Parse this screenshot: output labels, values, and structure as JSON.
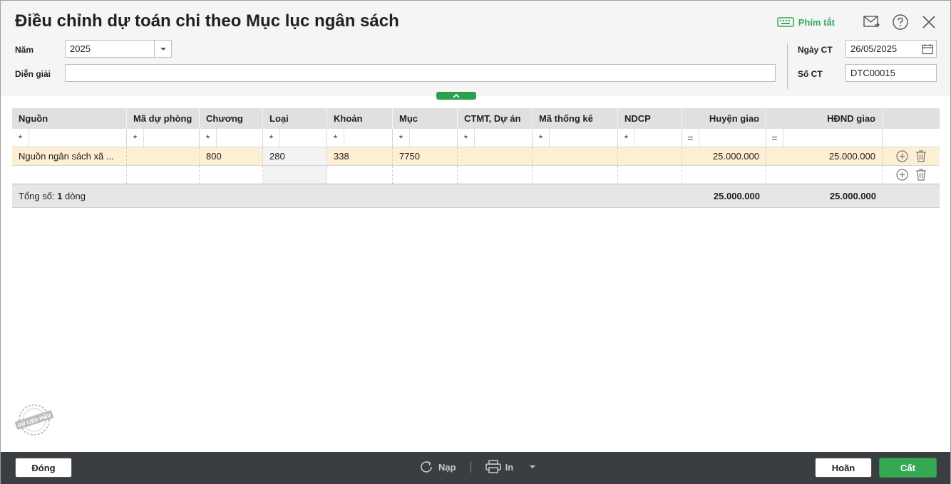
{
  "window": {
    "title": "Điều chỉnh dự toán chi theo Mục lục ngân sách",
    "shortcut_label": "Phím tắt"
  },
  "form": {
    "year_label": "Năm",
    "year_value": "2025",
    "description_label": "Diễn giải",
    "description_value": "",
    "date_label": "Ngày CT",
    "date_value": "26/05/2025",
    "doc_no_label": "Số CT",
    "doc_no_value": "DTC00015"
  },
  "table": {
    "columns": [
      "Nguồn",
      "Mã dự phòng",
      "Chương",
      "Loại",
      "Khoản",
      "Mục",
      "CTMT, Dự án",
      "Mã thống kê",
      "NDCP",
      "Huyện giao",
      "HĐND giao"
    ],
    "filter_ops": [
      "*",
      "*",
      "*",
      "*",
      "*",
      "*",
      "*",
      "*",
      "*",
      "=",
      "="
    ],
    "rows": [
      [
        "Nguồn ngân sách xã ...",
        "",
        "800",
        "280",
        "338",
        "7750",
        "",
        "",
        "",
        "25.000.000",
        "25.000.000"
      ]
    ],
    "footer": {
      "count_prefix": "Tổng số: ",
      "count_value": "1",
      "count_suffix": " dòng",
      "total_huyen": "25.000.000",
      "total_hdnd": "25.000.000"
    }
  },
  "watermark_text": "DỮ LIỆU MẪU",
  "buttons": {
    "close": "Đóng",
    "reload": "Nạp",
    "print": "In",
    "cancel": "Hoãn",
    "save": "Cất"
  },
  "colors": {
    "accent_green": "#36a852",
    "row_highlight": "#fcefd2",
    "footer_bar": "#3a3d42"
  }
}
